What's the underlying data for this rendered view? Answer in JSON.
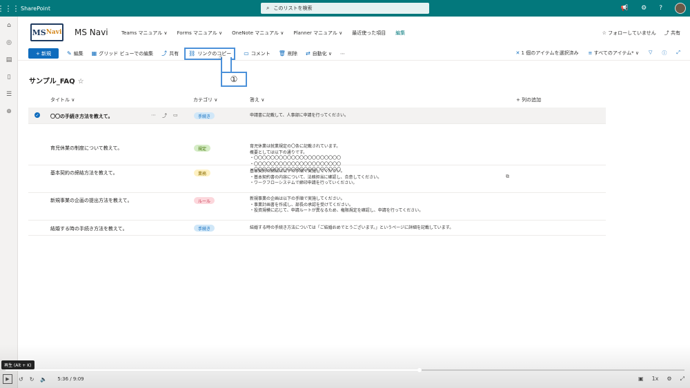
{
  "suite": {
    "app_name": "SharePoint",
    "search_placeholder": "このリストを検索"
  },
  "site": {
    "logo_text": "MS",
    "logo_sub": "Navi",
    "name": "MS Navi",
    "nav": [
      "Teams マニュアル ∨",
      "Forms マニュアル ∨",
      "OneNote マニュアル ∨",
      "Planner マニュアル ∨",
      "最近使った項目",
      "編集"
    ],
    "follow": "☆ フォローしていません",
    "share": "共有"
  },
  "commands": {
    "new": "+ 新規",
    "edit": "編集",
    "grid_edit": "グリッド ビューでの編集",
    "share": "共有",
    "copy_link": "リンクのコピー",
    "comment": "コメント",
    "delete": "削除",
    "automate": "自動化 ∨",
    "more": "⋯",
    "selected": "1 個のアイテムを選択済み",
    "all_items": "すべてのアイテム* ∨"
  },
  "callout": {
    "label": "①"
  },
  "list": {
    "title": "サンプル_FAQ",
    "columns": {
      "title": "タイトル ∨",
      "category": "カテゴリ ∨",
      "answer": "答え ∨",
      "add": "+ 列の追加"
    },
    "rows": [
      {
        "title": "〇〇の手続き方法を教えて。",
        "category": "手続き",
        "cat_color": "#d0e7f8",
        "cat_text": "#0f6cbd",
        "answer": [
          "申請書に記載して、人事部に申請を行ってください。"
        ]
      },
      {
        "title": "育児休業の制度について教えて。",
        "category": "規定",
        "cat_color": "#d5ecc6",
        "cat_text": "#437406",
        "answer": [
          "育児休業は就業規定の〇条に記載されています。",
          "概要としては以下の通りです。",
          "・〇〇〇〇〇〇〇〇〇〇〇〇〇〇〇〇〇〇〇〇〇",
          "・〇〇〇〇〇〇〇〇〇〇〇〇〇〇〇〇〇〇〇〇〇",
          "・〇〇〇〇〇〇〇〇〇〇〇〇〇〇〇〇〇〇〇〇〇"
        ]
      },
      {
        "title": "基本契約の締結方法を教えて。",
        "category": "業務",
        "cat_color": "#fef1c2",
        "cat_text": "#8a6d00",
        "answer": [
          "基本契約の締結は以下の手順で実施してください。",
          "・基本契約書の内容について、法務担当に確認し、合意してください。",
          "・ワークフローシステムで締印申請を行っていください。"
        ]
      },
      {
        "title": "新規事業の企画の提出方法を教えて。",
        "category": "ルール",
        "cat_color": "#fcd7dc",
        "cat_text": "#c4314b",
        "answer": [
          "新規事業の企画は以下の手順で実施してください。",
          "・事業計画書を作成し、部長の承認を受けてください。",
          "・投資規模に応じて、申請ルートが異なるため、権限規定を確認し、申請を行ってください。"
        ]
      },
      {
        "title": "結婚する時の手続き方法を教えて。",
        "category": "手続き",
        "cat_color": "#d0e7f8",
        "cat_text": "#0f6cbd",
        "answer": [
          "結婚する時の手続き方法については「ご結婚おめでとうございます。」というページに詳細を記載しています。"
        ]
      }
    ]
  },
  "video": {
    "tooltip": "再生 (Alt + K)",
    "time": "5:36 / 9:09",
    "speed": "1x",
    "progress": 0.61
  }
}
